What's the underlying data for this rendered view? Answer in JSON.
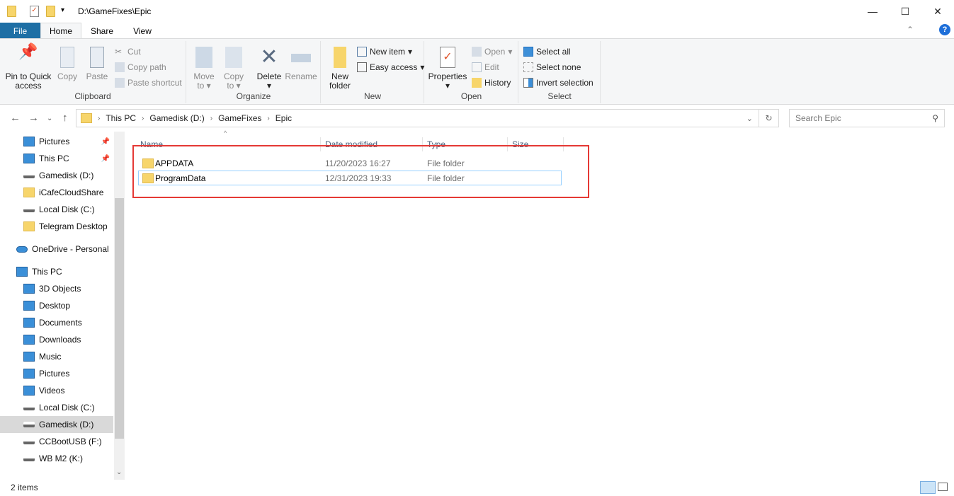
{
  "window": {
    "title": "D:\\GameFixes\\Epic",
    "minimize": "—",
    "maximize": "☐",
    "close": "✕"
  },
  "tabs": [
    "File",
    "Home",
    "Share",
    "View"
  ],
  "ribbon": {
    "clipboard": {
      "label": "Clipboard",
      "pin": "Pin to Quick access",
      "pin1": "Pin to Quick",
      "pin2": "access",
      "copy": "Copy",
      "paste": "Paste",
      "cut": "Cut",
      "copy_path": "Copy path",
      "paste_shortcut": "Paste shortcut"
    },
    "organize": {
      "label": "Organize",
      "move1": "Move",
      "move2": "to",
      "copy1": "Copy",
      "copy2": "to",
      "delete": "Delete",
      "rename": "Rename"
    },
    "new": {
      "label": "New",
      "new_folder1": "New",
      "new_folder2": "folder",
      "new_item": "New item",
      "easy_access": "Easy access"
    },
    "open": {
      "label": "Open",
      "properties": "Properties",
      "open": "Open",
      "edit": "Edit",
      "history": "History"
    },
    "select": {
      "label": "Select",
      "select_all": "Select all",
      "select_none": "Select none",
      "invert": "Invert selection"
    }
  },
  "address": {
    "crumbs": [
      "This PC",
      "Gamedisk (D:)",
      "GameFixes",
      "Epic"
    ],
    "search_placeholder": "Search Epic"
  },
  "sidebar": [
    {
      "label": "Pictures",
      "icon": "pictures-icon",
      "pinned": true
    },
    {
      "label": "This PC",
      "icon": "this-pc-icon",
      "pinned": true
    },
    {
      "label": "Gamedisk (D:)",
      "icon": "drive-icon"
    },
    {
      "label": "iCafeCloudShare",
      "icon": "folder-icon"
    },
    {
      "label": "Local Disk (C:)",
      "icon": "drive-icon"
    },
    {
      "label": "Telegram Desktop",
      "icon": "folder-icon"
    },
    {
      "label": "OneDrive - Personal",
      "icon": "onedrive-icon",
      "top": true
    },
    {
      "label": "This PC",
      "icon": "this-pc-icon",
      "top": true
    },
    {
      "label": "3D Objects",
      "icon": "3d-objects-icon"
    },
    {
      "label": "Desktop",
      "icon": "desktop-icon"
    },
    {
      "label": "Documents",
      "icon": "documents-icon"
    },
    {
      "label": "Downloads",
      "icon": "downloads-icon"
    },
    {
      "label": "Music",
      "icon": "music-icon"
    },
    {
      "label": "Pictures",
      "icon": "pictures-icon"
    },
    {
      "label": "Videos",
      "icon": "videos-icon"
    },
    {
      "label": "Local Disk (C:)",
      "icon": "drive-icon"
    },
    {
      "label": "Gamedisk (D:)",
      "icon": "drive-icon",
      "selected": true
    },
    {
      "label": "CCBootUSB (F:)",
      "icon": "drive-icon"
    },
    {
      "label": "WB M2 (K:)",
      "icon": "drive-icon"
    }
  ],
  "columns": [
    "Name",
    "Date modified",
    "Type",
    "Size"
  ],
  "files": [
    {
      "name": "APPDATA",
      "date": "11/20/2023 16:27",
      "type": "File folder",
      "size": ""
    },
    {
      "name": "ProgramData",
      "date": "12/31/2023 19:33",
      "type": "File folder",
      "size": "",
      "selected": true
    }
  ],
  "status": {
    "count": "2 items"
  },
  "colors": {
    "file_tab": "#1e6fa5",
    "highlight": "#e53935",
    "selection": "#99d1ff"
  }
}
